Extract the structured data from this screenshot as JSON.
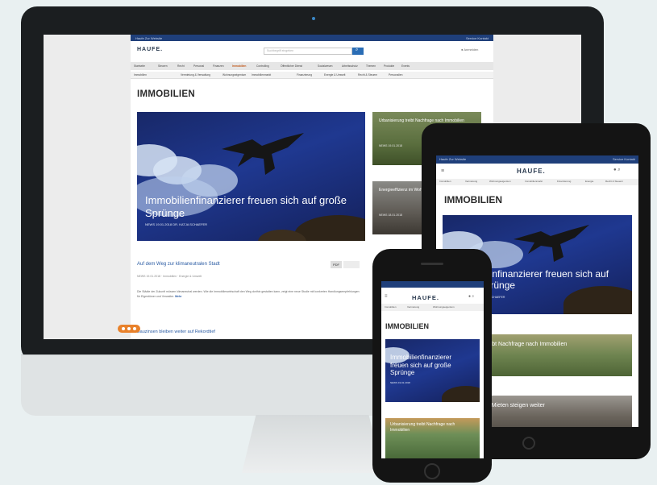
{
  "brand": {
    "logo": "HAUFE."
  },
  "desktop": {
    "topbar": {
      "left": "Haufe Zur Website",
      "right": "Service Kontakt"
    },
    "search_placeholder": "Suchbegriff eingeben",
    "user_label": "Anmelden",
    "nav_primary": [
      "Startseite",
      "Steuern",
      "Recht",
      "Personal",
      "Finanzen",
      "Immobilien",
      "Controlling",
      "Öffentlicher Dienst",
      "Sozialwesen",
      "Arbeitsschutz",
      "Themen",
      "Produkte",
      "Events"
    ],
    "nav_secondary": [
      "Immobilien",
      "Vermietung & Verwaltung",
      "Wohnungseigentum",
      "Immobilienmarkt",
      "Finanzierung",
      "Energie & Umwelt",
      "Recht & Steuern",
      "Personalien"
    ],
    "page_title": "IMMOBILIEN",
    "hero": {
      "title": "Immobilienfinanzierer freuen sich auf große Sprünge",
      "meta": "NEWS 19.01.2018 DR. KATJA SCHAEFER"
    },
    "side_cards": [
      {
        "title": "Urbanisierung treibt Nachfrage nach Immobilien",
        "meta": "NEWS 19.01.2018"
      },
      {
        "title": "Energieeffizienz im Wohnungsbau steigt",
        "meta": "NEWS 18.01.2018"
      }
    ],
    "article": {
      "title": "Auf dem Weg zur klimaneutralen Stadt",
      "meta": "NEWS 19.01.2018 · Immobilien · Energie & Umwelt",
      "body": "Die Städte der Zukunft müssen klimaneutral werden. Wie die Immobilienwirtschaft den Weg dorthin gestalten kann, zeigt eine neue Studie mit konkreten Handlungsempfehlungen für Eigentümer und Verwalter.",
      "more": "Mehr"
    },
    "article2_title": "Bauzinsen bleiben weiter auf Rekordtief",
    "badges": {
      "a": "PDF"
    }
  },
  "tablet": {
    "topbar": {
      "left": "Haufe Zur Website",
      "right": "Service Kontakt"
    },
    "nav": [
      "Immobilien",
      "Vermietung",
      "Wohnungseigentum",
      "Immobilienmarkt",
      "Finanzierung",
      "Energie",
      "Recht & Steuern"
    ],
    "page_title": "IMMOBILIEN",
    "hero_title": "Immobilienfinanzierer freuen sich auf große Sprünge",
    "hero_meta": "NEWS 19.01.2018 DR. KATJA SCHAEFER",
    "cards": [
      "Urbanisierung treibt Nachfrage nach Immobilien",
      "Wohnungsmarkt: Mieten steigen weiter"
    ]
  },
  "phone": {
    "nav": [
      "Immobilien",
      "Vermietung",
      "Wohnungseigentum"
    ],
    "page_title": "IMMOBILIEN",
    "hero_title": "Immobilienfinanzierer freuen sich auf große Sprünge",
    "hero_meta": "NEWS 19.01.2018",
    "card": "Urbanisierung treibt Nachfrage nach Immobilien"
  },
  "colors": {
    "brand_blue": "#1f3f7a",
    "link_blue": "#2a5ba3",
    "accent_orange": "#e8812b",
    "background": "#e9f0f1"
  }
}
